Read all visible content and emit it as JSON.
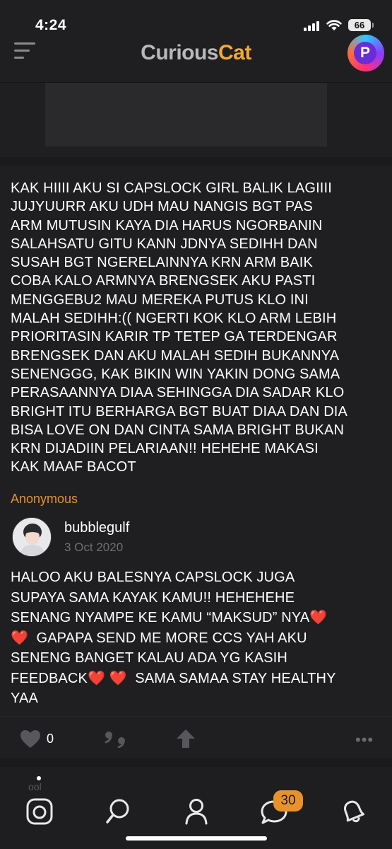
{
  "status_bar": {
    "time": "4:24",
    "battery": "66"
  },
  "header": {
    "logo_part1": "Curious",
    "logo_part2": "Cat",
    "profile_letter": "P"
  },
  "post": {
    "question_lines": [
      "KAK HIIII AKU SI CAPSLOCK GIRL BALIK LAGIIII",
      "JUJYUURR AKU UDH MAU NANGIS BGT PAS",
      "ARM MUTUSIN KAYA DIA HARUS NGORBANIN",
      "SALAHSATU GITU KANN JDNYA SEDIHH DAN",
      "SUSAH BGT NGERELAINNYA KRN ARM BAIK",
      "COBA KALO ARMNYA BRENGSEK AKU PASTI",
      "MENGGEBU2 MAU MEREKA PUTUS KLO INI",
      "MALAH SEDIHH:(( NGERTI KOK KLO ARM LEBIH",
      "PRIORITASIN KARIR TP TETEP GA TERDENGAR",
      "BRENGSEK DAN AKU MALAH SEDIH BUKANNYA",
      "SENENGGG, KAK BIKIN WIN YAKIN DONG SAMA",
      "PERASAANNYA DIAA SEHINGGA DIA SADAR KLO",
      "BRIGHT ITU BERHARGA BGT BUAT DIAA DAN DIA",
      "BISA LOVE ON DAN CINTA SAMA BRIGHT BUKAN",
      "KRN DIJADIIN PELARIAAN!! HEHEHE MAKASI",
      "KAK MAAF BACOT"
    ],
    "asker": "Anonymous",
    "username": "bubblegulf",
    "date": "3 Oct 2020",
    "answer_l1": "HALOO AKU BALESNYA CAPSLOCK JUGA",
    "answer_l2": "SUPAYA SAMA KAYAK KAMU!! HEHEHEHE",
    "answer_l3": "SENANG NYAMPE KE KAMU “MAKSUD” NYA",
    "answer_l4": "GAPAPA SEND ME MORE CCS YAH AKU",
    "answer_l5": "SENENG BANGET KALAU ADA YG KASIH",
    "answer_l6a": "FEEDBACK",
    "answer_l6b": "SAMA SAMAA STAY HEALTHY",
    "answer_l7": "YAA",
    "heart": "❤️",
    "like_count": "0",
    "more": "•••"
  },
  "tab_bar": {
    "peek_text": "ool",
    "notification_count": "30"
  },
  "icons": [
    "menu-icon",
    "heart-icon",
    "quote-icon",
    "share-arrow-icon",
    "more-icon",
    "camera-icon",
    "search-icon",
    "profile-icon",
    "chat-icon",
    "notifications-icon"
  ],
  "colors": {
    "background": "#1f1f21",
    "accent": "#e8922d",
    "logo_orange": "#f0a93a",
    "logo_gray": "#b9b9b9"
  }
}
